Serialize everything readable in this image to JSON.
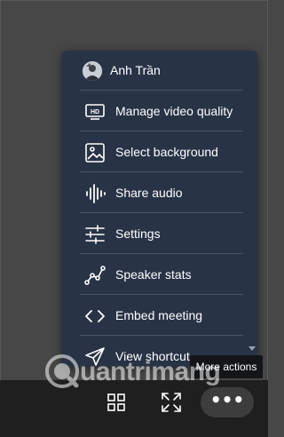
{
  "menu": {
    "user": {
      "name": "Anh Trần"
    },
    "items": [
      {
        "label": "Manage video quality",
        "icon": "hd-icon"
      },
      {
        "label": "Select background",
        "icon": "image-icon"
      },
      {
        "label": "Share audio",
        "icon": "audio-wave-icon"
      },
      {
        "label": "Settings",
        "icon": "sliders-icon"
      },
      {
        "label": "Speaker stats",
        "icon": "stats-icon"
      },
      {
        "label": "Embed meeting",
        "icon": "code-icon"
      },
      {
        "label": "View shortcut",
        "icon": "send-icon"
      }
    ]
  },
  "toolbar": {
    "more_label": "•••",
    "tooltip": "More actions"
  },
  "watermark": {
    "text": "uantrimang"
  },
  "colors": {
    "menu_bg": "#283346",
    "page_bg": "#474747",
    "toolbar_bg": "#1f1f1f"
  }
}
